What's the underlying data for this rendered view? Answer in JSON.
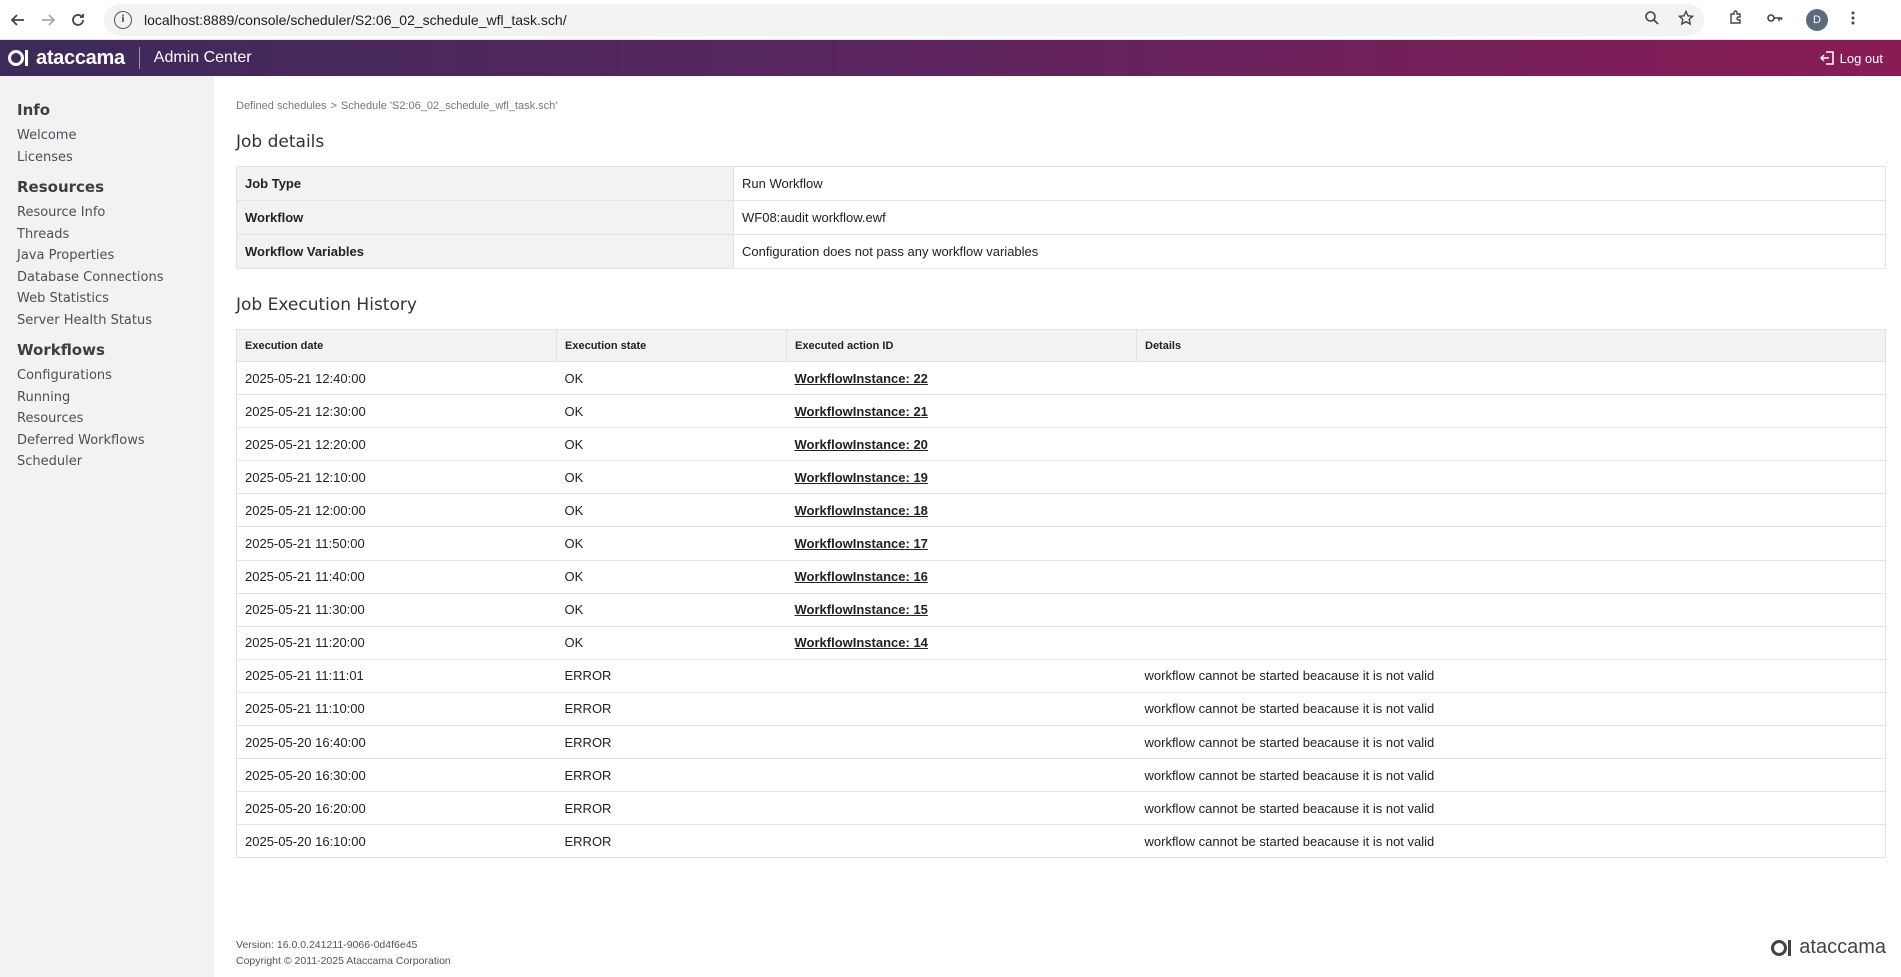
{
  "browser": {
    "url": "localhost:8889/console/scheduler/S2:06_02_schedule_wfl_task.sch/",
    "avatar_letter": "D"
  },
  "header": {
    "brand": "ataccama",
    "title": "Admin Center",
    "logout_label": "Log out"
  },
  "sidebar": {
    "sections": [
      {
        "title": "Info",
        "items": [
          "Welcome",
          "Licenses"
        ]
      },
      {
        "title": "Resources",
        "items": [
          "Resource Info",
          "Threads",
          "Java Properties",
          "Database Connections",
          "Web Statistics",
          "Server Health Status"
        ]
      },
      {
        "title": "Workflows",
        "items": [
          "Configurations",
          "Running",
          "Resources",
          "Deferred Workflows",
          "Scheduler"
        ]
      }
    ]
  },
  "breadcrumb": {
    "root": "Defined schedules",
    "separator": ">",
    "current": "Schedule 'S2:06_02_schedule_wfl_task.sch'"
  },
  "job_details": {
    "title": "Job details",
    "rows": [
      {
        "key": "Job Type",
        "value": "Run Workflow"
      },
      {
        "key": "Workflow",
        "value": "WF08:audit workflow.ewf"
      },
      {
        "key": "Workflow Variables",
        "value": "Configuration does not pass any workflow variables"
      }
    ]
  },
  "history": {
    "title": "Job Execution History",
    "columns": [
      "Execution date",
      "Execution state",
      "Executed action ID",
      "Details"
    ],
    "rows": [
      [
        "2025-05-21 12:40:00",
        "OK",
        "WorkflowInstance: 22",
        ""
      ],
      [
        "2025-05-21 12:30:00",
        "OK",
        "WorkflowInstance: 21",
        ""
      ],
      [
        "2025-05-21 12:20:00",
        "OK",
        "WorkflowInstance: 20",
        ""
      ],
      [
        "2025-05-21 12:10:00",
        "OK",
        "WorkflowInstance: 19",
        ""
      ],
      [
        "2025-05-21 12:00:00",
        "OK",
        "WorkflowInstance: 18",
        ""
      ],
      [
        "2025-05-21 11:50:00",
        "OK",
        "WorkflowInstance: 17",
        ""
      ],
      [
        "2025-05-21 11:40:00",
        "OK",
        "WorkflowInstance: 16",
        ""
      ],
      [
        "2025-05-21 11:30:00",
        "OK",
        "WorkflowInstance: 15",
        ""
      ],
      [
        "2025-05-21 11:20:00",
        "OK",
        "WorkflowInstance: 14",
        ""
      ],
      [
        "2025-05-21 11:11:01",
        "ERROR",
        "",
        "workflow cannot be started beacause it is not valid"
      ],
      [
        "2025-05-21 11:10:00",
        "ERROR",
        "",
        "workflow cannot be started beacause it is not valid"
      ],
      [
        "2025-05-20 16:40:00",
        "ERROR",
        "",
        "workflow cannot be started beacause it is not valid"
      ],
      [
        "2025-05-20 16:30:00",
        "ERROR",
        "",
        "workflow cannot be started beacause it is not valid"
      ],
      [
        "2025-05-20 16:20:00",
        "ERROR",
        "",
        "workflow cannot be started beacause it is not valid"
      ],
      [
        "2025-05-20 16:10:00",
        "ERROR",
        "",
        "workflow cannot be started beacause it is not valid"
      ]
    ]
  },
  "footer": {
    "version": "Version: 16.0.0.241211-9066-0d4f6e45",
    "copyright": "Copyright © 2011-2025 Ataccama Corporation",
    "brand": "ataccama"
  }
}
